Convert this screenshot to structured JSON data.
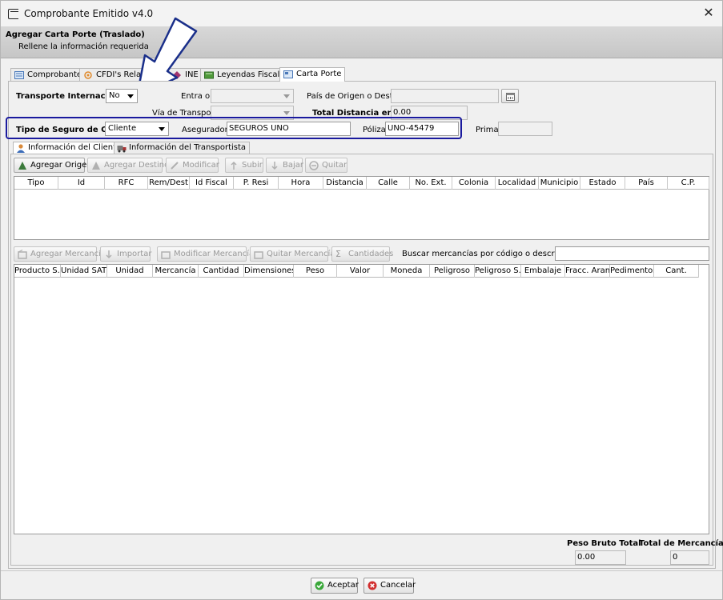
{
  "window": {
    "title": "Comprobante Emitido v4.0"
  },
  "banner": {
    "title": "Agregar Carta Porte (Traslado)",
    "subtitle": "Rellene la información requerida"
  },
  "tabs": [
    {
      "label": "Comprobante",
      "icon": "document-icon"
    },
    {
      "label": "CFDI's Relac",
      "icon": "related-icon"
    },
    {
      "label": "INE",
      "icon": "diamond-icon"
    },
    {
      "label": "Leyendas Fiscales",
      "icon": "book-icon"
    },
    {
      "label": "Carta Porte",
      "icon": "card-icon"
    }
  ],
  "form": {
    "transporte_internacional_label": "Transporte Internacional",
    "transporte_internacional_value": "No",
    "entra_sale_label": "Entra o Sale",
    "pais_label": "País de Origen o Destino",
    "via_label": "Vía de Transporte",
    "total_distancia_label": "Total Distancia en KM",
    "total_distancia_value": "0.00",
    "tipo_seguro_label": "Tipo de Seguro de Carga",
    "tipo_seguro_value": "Cliente",
    "aseguradora_label": "Aseguradora",
    "aseguradora_value": "SEGUROS UNO",
    "poliza_label": "Póliza",
    "poliza_value": "UNO-45479",
    "prima_label": "Prima"
  },
  "subtabs": [
    {
      "label": "Información del Cliente"
    },
    {
      "label": "Información del Transportista"
    }
  ],
  "ubicaciones_toolbar": {
    "agregar_origen": "Agregar Origen",
    "agregar_destino": "Agregar Destino",
    "modificar": "Modificar",
    "subir": "Subir",
    "bajar": "Bajar",
    "quitar": "Quitar"
  },
  "ubicaciones_columns": [
    "Tipo",
    "Id",
    "RFC",
    "Rem/Dest",
    "Id Fiscal",
    "P. Resi",
    "Hora",
    "Distancia",
    "Calle",
    "No. Ext.",
    "Colonia",
    "Localidad",
    "Municipio",
    "Estado",
    "País",
    "C.P."
  ],
  "mercancias_toolbar": {
    "agregar": "Agregar Mercancía",
    "importar": "Importar",
    "modificar": "Modificar Mercancía",
    "quitar": "Quitar Mercancía",
    "cantidades": "Cantidades",
    "buscar_label": "Buscar mercancías por código o descripción:"
  },
  "mercancias_columns": [
    "Producto S...",
    "Unidad SAT",
    "Unidad",
    "Mercancía",
    "Cantidad",
    "Dimensiones",
    "Peso",
    "Valor",
    "Moneda",
    "Peligroso",
    "Peligroso S...",
    "Embalaje",
    "Fracc. Aran.",
    "Pedimentos",
    "Cant."
  ],
  "totals": {
    "peso_bruto_label": "Peso Bruto Total",
    "peso_bruto_value": "0.00",
    "total_mercancias_label": "Total de Mercancías",
    "total_mercancias_value": "0"
  },
  "footer": {
    "aceptar": "Aceptar",
    "cancelar": "Cancelar"
  },
  "colors": {
    "highlight_box": "#1a1a9e",
    "accept_icon": "#3aa83a",
    "cancel_icon": "#d23030"
  }
}
